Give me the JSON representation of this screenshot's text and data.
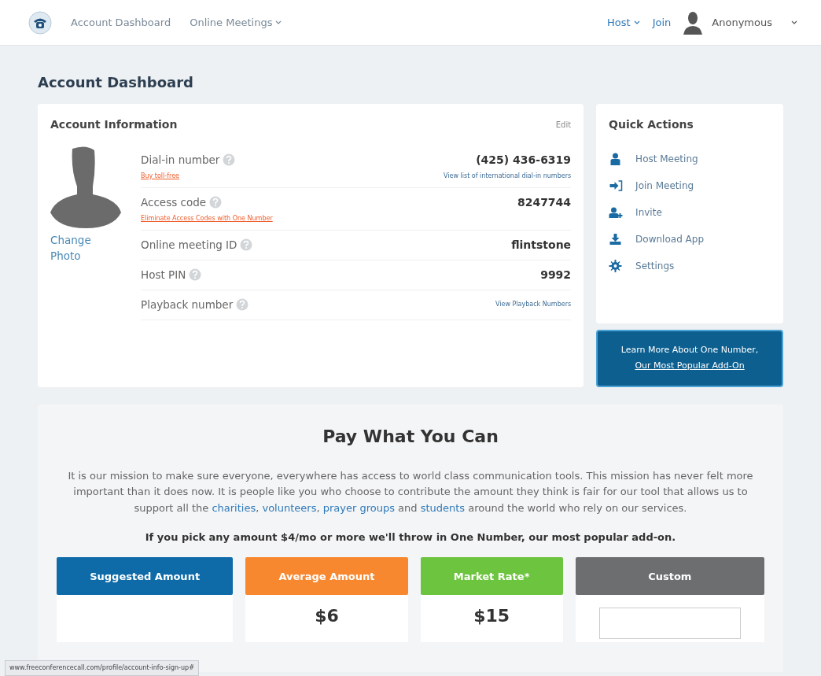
{
  "navbar": {
    "left": [
      {
        "label": "Account Dashboard",
        "dropdown": false
      },
      {
        "label": "Online Meetings",
        "dropdown": true
      }
    ],
    "right": [
      {
        "label": "Host",
        "dropdown": true
      },
      {
        "label": "Join",
        "dropdown": false
      }
    ],
    "user": "Anonymous"
  },
  "page_title": "Account Dashboard",
  "account_info": {
    "title": "Account Information",
    "edit": "Edit",
    "change_photo": "Change Photo",
    "rows": [
      {
        "label": "Dial-in number",
        "value": "(425) 436-6319",
        "sub_left": "Buy toll-free",
        "sub_right": "View list of international dial-in numbers"
      },
      {
        "label": "Access code",
        "value": "8247744",
        "sub_left": "Eliminate Access Codes with One Number"
      },
      {
        "label": "Online meeting ID",
        "value": "flintstone"
      },
      {
        "label": "Host PIN",
        "value": "9992"
      },
      {
        "label": "Playback number",
        "link": "View Playback Numbers"
      }
    ]
  },
  "quick_actions": {
    "title": "Quick Actions",
    "items": [
      {
        "label": "Host Meeting",
        "kind": "host"
      },
      {
        "label": "Join Meeting",
        "kind": "join"
      },
      {
        "label": "Invite",
        "kind": "invite"
      },
      {
        "label": "Download App",
        "kind": "download"
      },
      {
        "label": "Settings",
        "kind": "settings"
      }
    ]
  },
  "promo": {
    "line1": "Learn More About One Number,",
    "line2": "Our Most Popular Add-On"
  },
  "pay": {
    "title": "Pay What You Can",
    "paragraph": [
      {
        "kind": "text",
        "text": "It is our mission to make sure everyone, everywhere has access to world class communication tools. This mission has never felt more important than it does now. It is people like you who choose to contribute the amount they think is fair for our tool that allows us to support all the "
      },
      {
        "kind": "link",
        "text": "charities"
      },
      {
        "kind": "text",
        "text": ", "
      },
      {
        "kind": "link",
        "text": "volunteers"
      },
      {
        "kind": "text",
        "text": ", "
      },
      {
        "kind": "link",
        "text": "prayer groups"
      },
      {
        "kind": "text",
        "text": " and "
      },
      {
        "kind": "link",
        "text": "students"
      },
      {
        "kind": "text",
        "text": " around the world who rely on our services."
      }
    ],
    "offer": "If you pick any amount $4/mo or more we'll throw in One Number, our most popular add-on.",
    "options": [
      {
        "label": "Suggested Amount",
        "color": "#0e6ba8"
      },
      {
        "label": "Average Amount",
        "color": "#f7882f",
        "price": "$6"
      },
      {
        "label": "Market Rate*",
        "color": "#6dc43f",
        "price": "$15"
      },
      {
        "label": "Custom",
        "color": "#6d6e70",
        "kind": "input"
      }
    ]
  },
  "status_bar": "www.freeconferencecall.com/profile/account-info-sign-up#"
}
